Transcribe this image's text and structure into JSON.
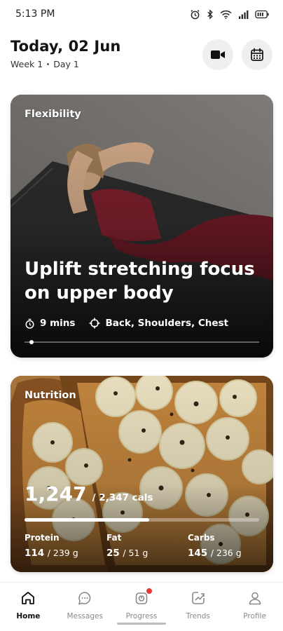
{
  "status_bar": {
    "time": "5:13 PM",
    "icons": [
      "alarm-icon",
      "bluetooth-icon",
      "wifi-icon",
      "signal-icon",
      "battery-icon"
    ]
  },
  "header": {
    "title": "Today, 02 Jun",
    "week": "Week 1",
    "day": "Day 1"
  },
  "actions": [
    "video-camera-icon",
    "calendar-icon"
  ],
  "flex_card": {
    "label": "Flexibility",
    "title": "Uplift stretching focus on upper body",
    "duration": "9 mins",
    "focus": "Back, Shoulders, Chest",
    "progress_fraction": 0.02
  },
  "nutrition_card": {
    "label": "Nutrition",
    "calories": "1,247",
    "calories_target": "/ 2,347 cals",
    "progress_fraction": 0.53,
    "macros": [
      {
        "name": "Protein",
        "value": "114",
        "target": "/ 239 g"
      },
      {
        "name": "Fat",
        "value": "25",
        "target": "/ 51 g"
      },
      {
        "name": "Carbs",
        "value": "145",
        "target": "/ 236 g"
      }
    ]
  },
  "nav": [
    {
      "label": "Home",
      "icon": "home-icon",
      "active": true
    },
    {
      "label": "Messages",
      "icon": "chat-icon",
      "active": false
    },
    {
      "label": "Progress",
      "icon": "progress-icon",
      "active": false,
      "badge": true
    },
    {
      "label": "Trends",
      "icon": "trends-icon",
      "active": false
    },
    {
      "label": "Profile",
      "icon": "profile-icon",
      "active": false
    }
  ],
  "colors": {
    "accent": "#111111",
    "badge": "#e53935",
    "card_overlay": "#000000"
  }
}
